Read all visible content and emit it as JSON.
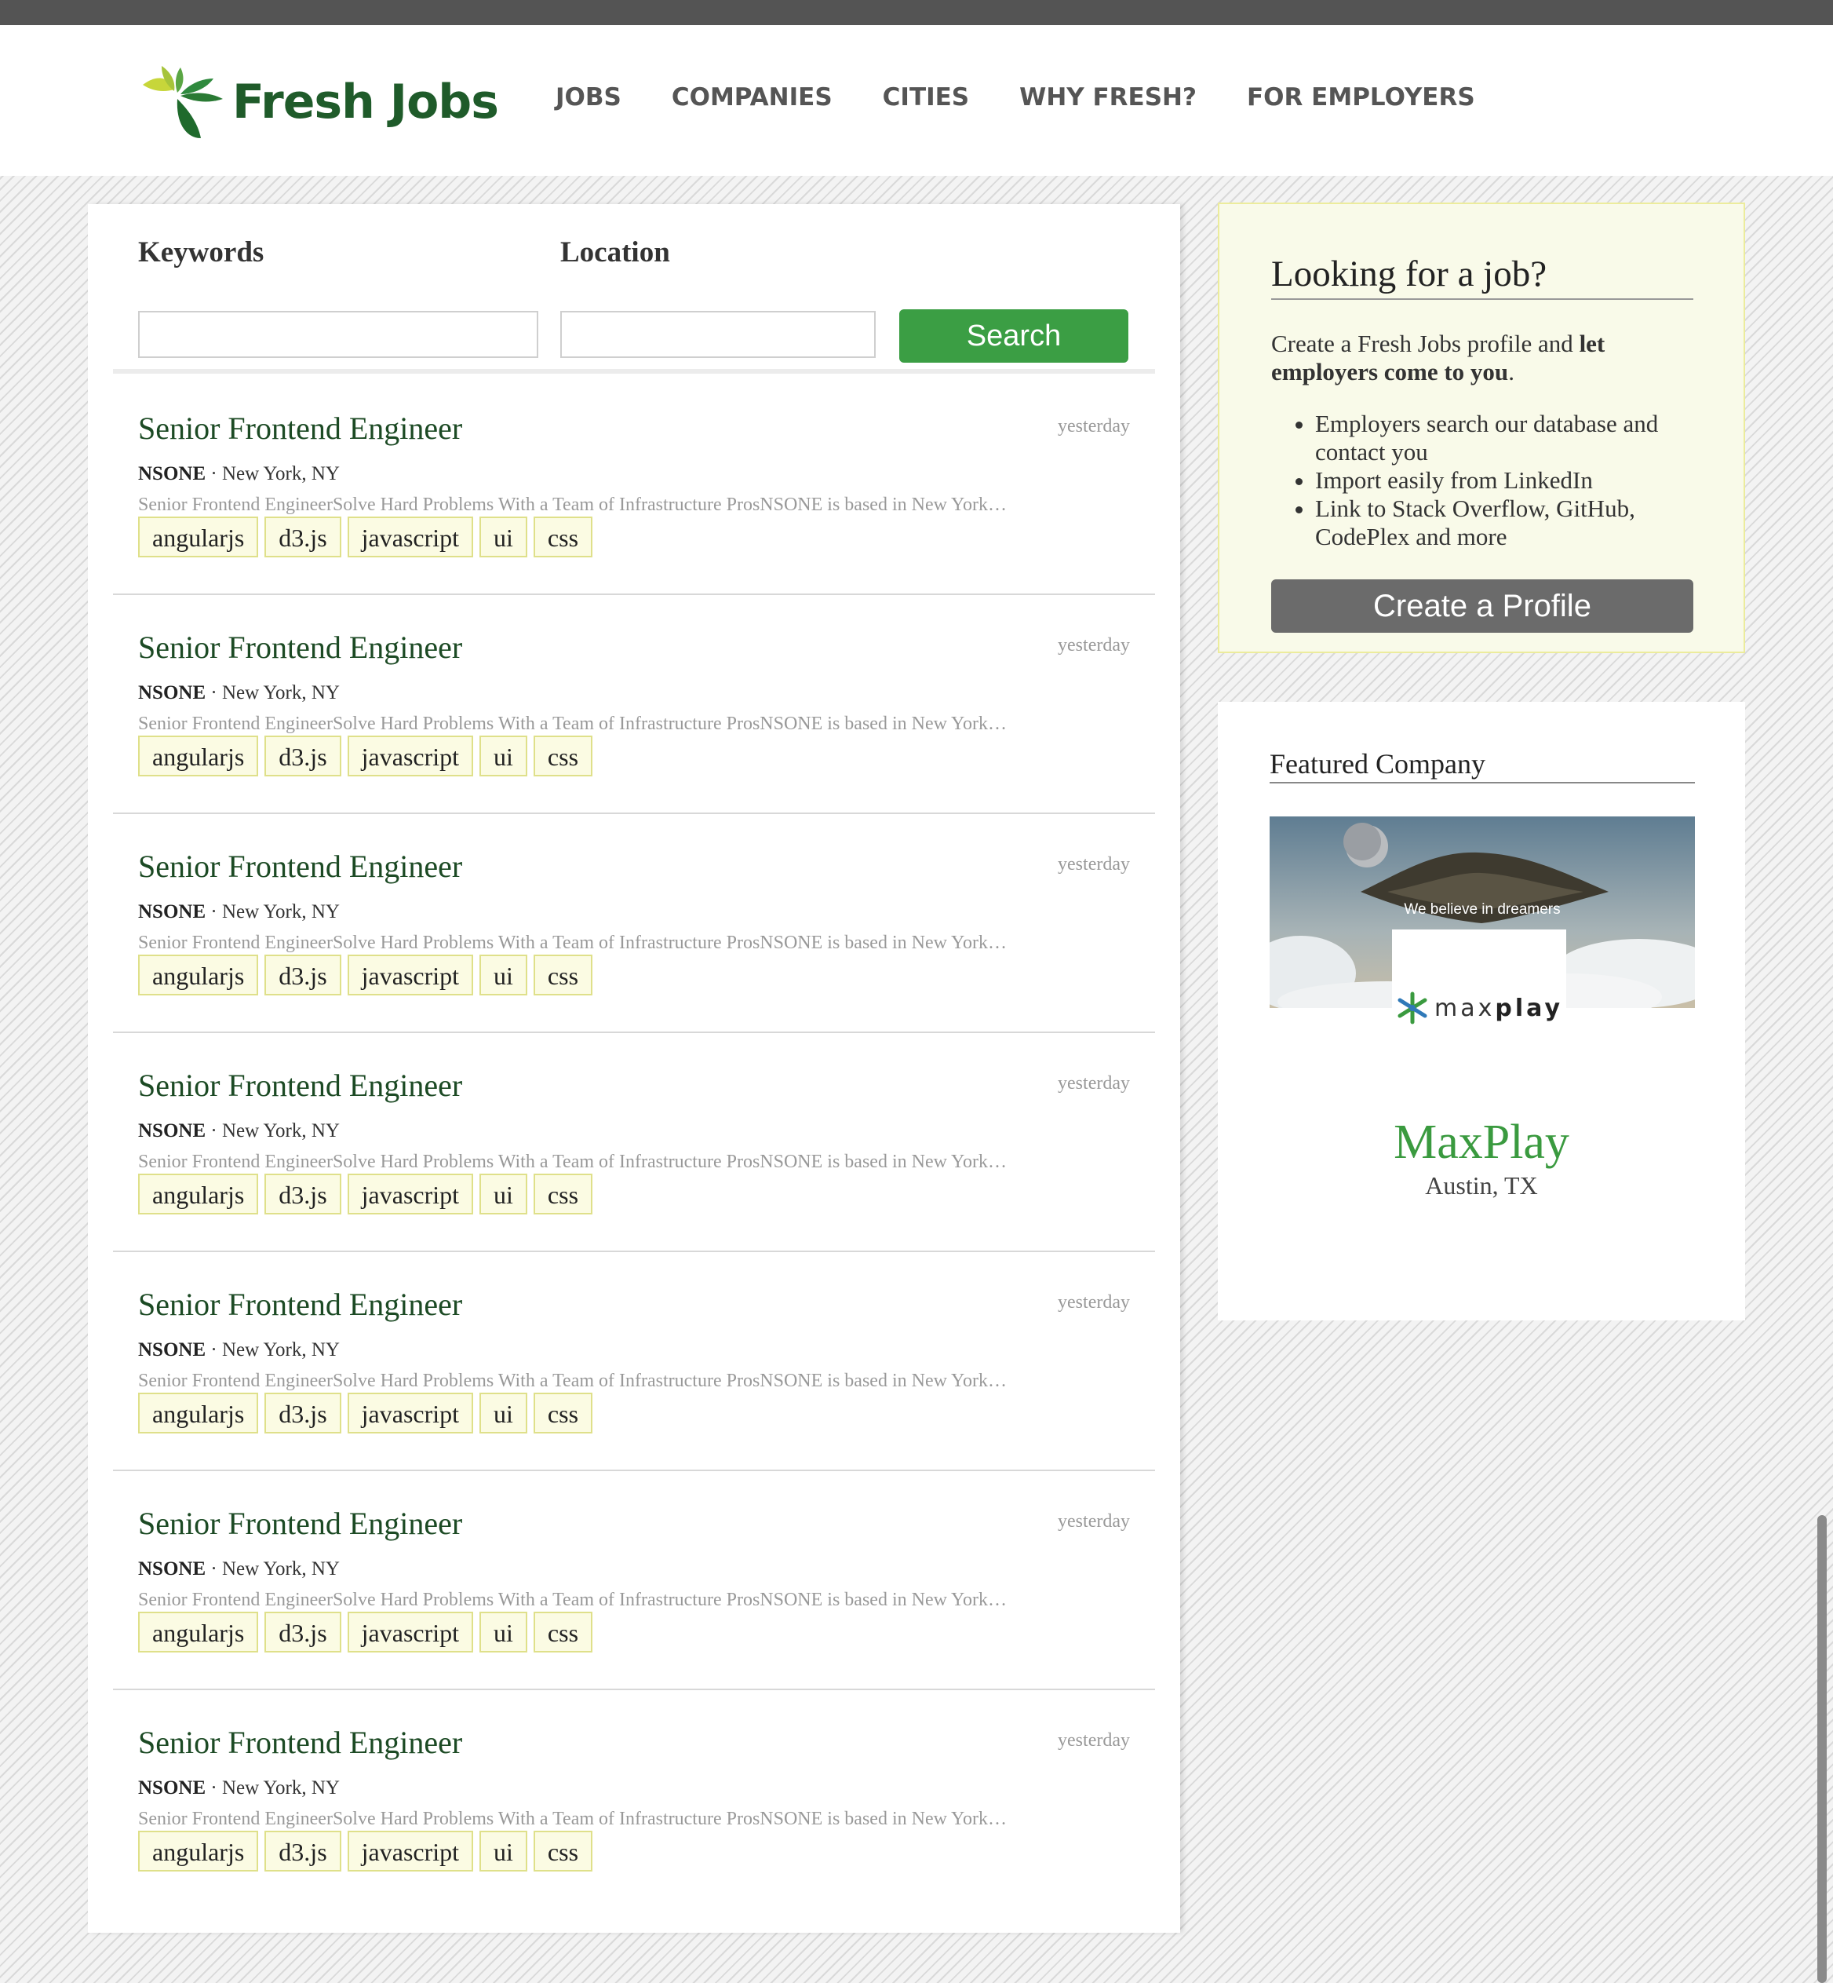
{
  "brand": {
    "name": "Fresh Jobs",
    "primary_color": "#1f5b2a",
    "accent_color": "#3b9e44"
  },
  "nav": [
    "JOBS",
    "COMPANIES",
    "CITIES",
    "WHY FRESH?",
    "FOR EMPLOYERS"
  ],
  "search": {
    "keywords_label": "Keywords",
    "keywords_value": "",
    "location_label": "Location",
    "location_value": "",
    "button_label": "Search"
  },
  "jobs": [
    {
      "title": "Senior Frontend Engineer",
      "date": "yesterday",
      "company": "NSONE",
      "location": "New York, NY",
      "description": "Senior Frontend EngineerSolve Hard Problems With a Team of Infrastructure ProsNSONE is based in New York…",
      "tags": [
        "angularjs",
        "d3.js",
        "javascript",
        "ui",
        "css"
      ]
    },
    {
      "title": "Senior Frontend Engineer",
      "date": "yesterday",
      "company": "NSONE",
      "location": "New York, NY",
      "description": "Senior Frontend EngineerSolve Hard Problems With a Team of Infrastructure ProsNSONE is based in New York…",
      "tags": [
        "angularjs",
        "d3.js",
        "javascript",
        "ui",
        "css"
      ]
    },
    {
      "title": "Senior Frontend Engineer",
      "date": "yesterday",
      "company": "NSONE",
      "location": "New York, NY",
      "description": "Senior Frontend EngineerSolve Hard Problems With a Team of Infrastructure ProsNSONE is based in New York…",
      "tags": [
        "angularjs",
        "d3.js",
        "javascript",
        "ui",
        "css"
      ]
    },
    {
      "title": "Senior Frontend Engineer",
      "date": "yesterday",
      "company": "NSONE",
      "location": "New York, NY",
      "description": "Senior Frontend EngineerSolve Hard Problems With a Team of Infrastructure ProsNSONE is based in New York…",
      "tags": [
        "angularjs",
        "d3.js",
        "javascript",
        "ui",
        "css"
      ]
    },
    {
      "title": "Senior Frontend Engineer",
      "date": "yesterday",
      "company": "NSONE",
      "location": "New York, NY",
      "description": "Senior Frontend EngineerSolve Hard Problems With a Team of Infrastructure ProsNSONE is based in New York…",
      "tags": [
        "angularjs",
        "d3.js",
        "javascript",
        "ui",
        "css"
      ]
    },
    {
      "title": "Senior Frontend Engineer",
      "date": "yesterday",
      "company": "NSONE",
      "location": "New York, NY",
      "description": "Senior Frontend EngineerSolve Hard Problems With a Team of Infrastructure ProsNSONE is based in New York…",
      "tags": [
        "angularjs",
        "d3.js",
        "javascript",
        "ui",
        "css"
      ]
    },
    {
      "title": "Senior Frontend Engineer",
      "date": "yesterday",
      "company": "NSONE",
      "location": "New York, NY",
      "description": "Senior Frontend EngineerSolve Hard Problems With a Team of Infrastructure ProsNSONE is based in New York…",
      "tags": [
        "angularjs",
        "d3.js",
        "javascript",
        "ui",
        "css"
      ]
    }
  ],
  "promo": {
    "title": "Looking for a job?",
    "intro_text": "Create a Fresh Jobs profile and ",
    "intro_bold": "let employers come to you",
    "intro_end": ".",
    "bullets": [
      "Employers search our database and contact you",
      "Import easily from LinkedIn",
      "Link to Stack Overflow, GitHub, CodePlex and more"
    ],
    "button_label": "Create a Profile"
  },
  "featured": {
    "heading": "Featured Company",
    "banner_text": "We believe in dreamers",
    "logo_wordmark_light": "max",
    "logo_wordmark_bold": "play",
    "company_name": "MaxPlay",
    "company_location": "Austin, TX"
  }
}
